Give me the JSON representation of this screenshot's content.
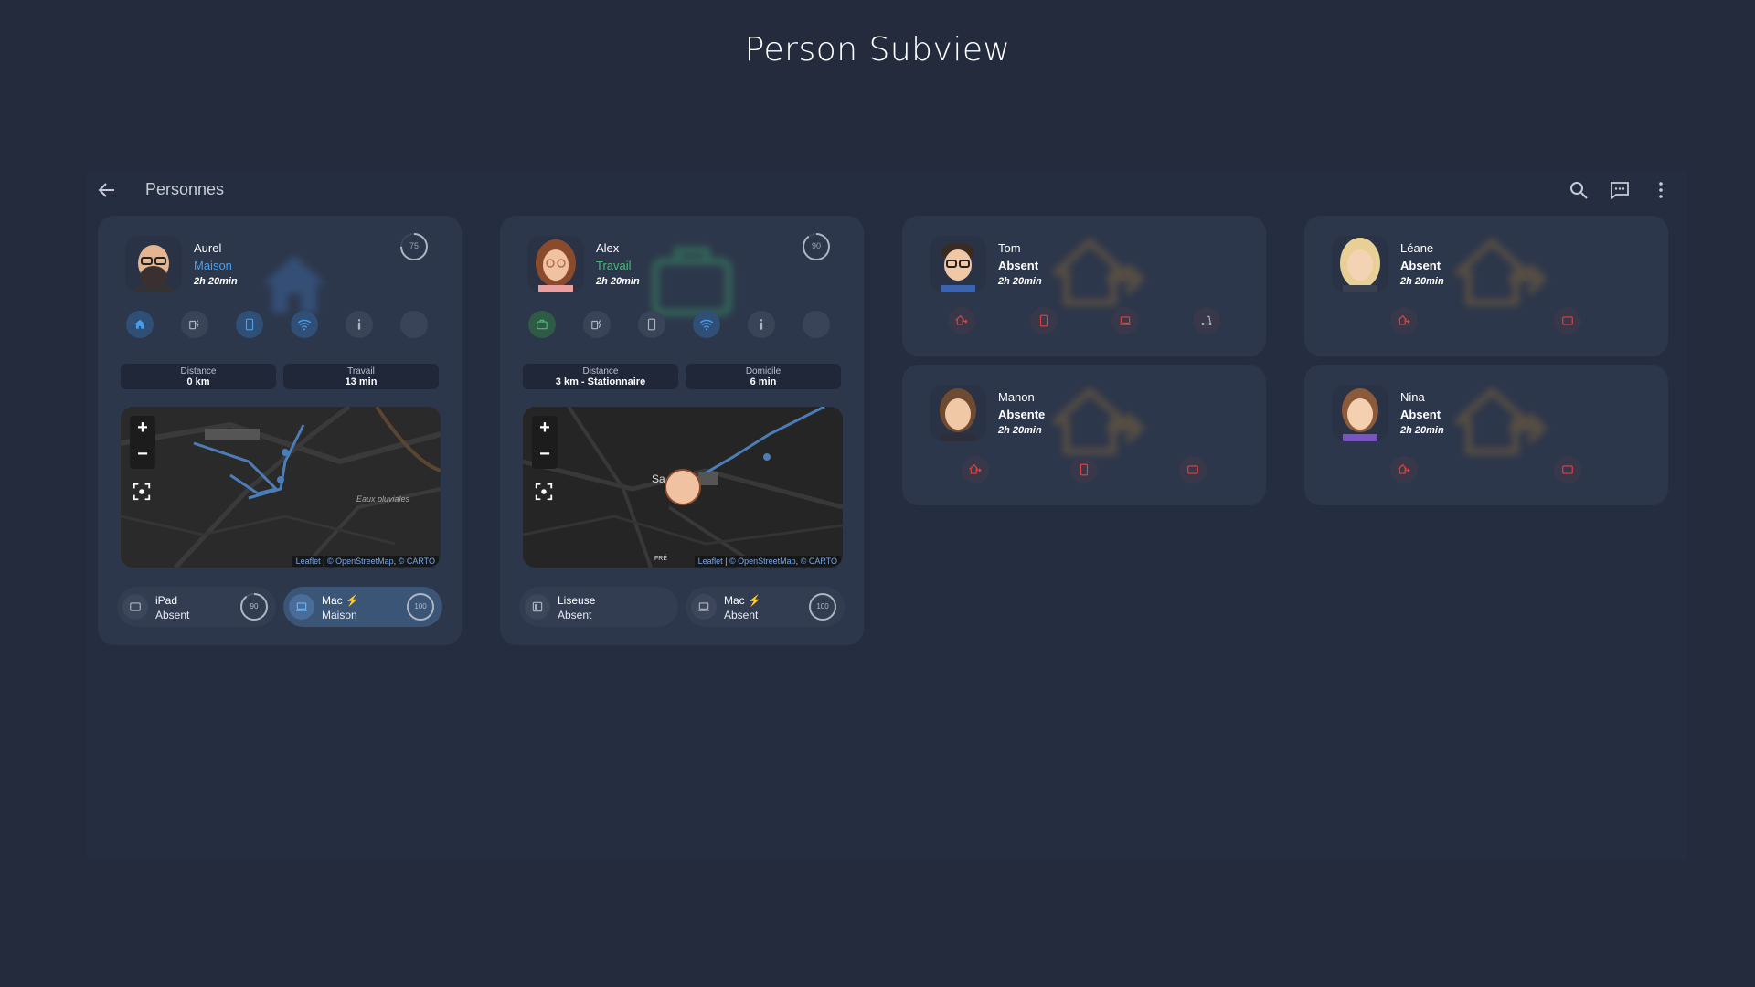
{
  "page_title": "Person Subview",
  "header": {
    "title": "Personnes"
  },
  "colors": {
    "home": "#4a9fe8",
    "work": "#4cb87a",
    "absent": "#e0413c",
    "ghost": "#8a6a3a"
  },
  "people": [
    {
      "name": "Aurel",
      "status": "Maison",
      "duration": "2h 20min",
      "battery": "75",
      "info": [
        {
          "label": "Distance",
          "value": "0 km"
        },
        {
          "label": "Travail",
          "value": "13 min"
        }
      ],
      "map_label": "Eaux pluviales",
      "devices": [
        {
          "name": "iPad",
          "status": "Absent",
          "battery": "90"
        },
        {
          "name": "Mac",
          "status": "Maison",
          "battery": "100"
        }
      ]
    },
    {
      "name": "Alex",
      "status": "Travail",
      "duration": "2h 20min",
      "battery": "90",
      "info": [
        {
          "label": "Distance",
          "value": "3 km - Stationnaire"
        },
        {
          "label": "Domicile",
          "value": "6 min"
        }
      ],
      "map_label": "Sa",
      "map_label_2": "FRÉ",
      "devices": [
        {
          "name": "Liseuse",
          "status": "Absent"
        },
        {
          "name": "Mac",
          "status": "Absent",
          "battery": "100"
        }
      ]
    },
    {
      "name": "Tom",
      "status": "Absent",
      "duration": "2h 20min"
    },
    {
      "name": "Léane",
      "status": "Absent",
      "duration": "2h 20min"
    },
    {
      "name": "Manon",
      "status": "Absente",
      "duration": "2h 20min"
    },
    {
      "name": "Nina",
      "status": "Absent",
      "duration": "2h 20min"
    }
  ],
  "map": {
    "zoom_in": "+",
    "zoom_out": "−",
    "attribution_leaflet": "Leaflet",
    "attribution_osm": "© OpenStreetMap",
    "attribution_carto": "© CARTO"
  }
}
